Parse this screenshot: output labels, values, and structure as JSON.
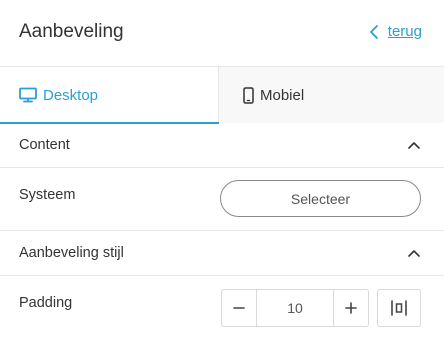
{
  "header": {
    "title": "Aanbeveling",
    "back_label": "terug"
  },
  "tabs": [
    {
      "label": "Desktop",
      "active": true,
      "icon": "desktop-icon"
    },
    {
      "label": "Mobiel",
      "active": false,
      "icon": "mobile-icon"
    }
  ],
  "sections": {
    "content": {
      "title": "Content",
      "fields": {
        "systeem": {
          "label": "Systeem",
          "button_label": "Selecteer"
        }
      }
    },
    "style": {
      "title": "Aanbeveling stijl",
      "fields": {
        "padding": {
          "label": "Padding",
          "value": "10"
        }
      }
    }
  },
  "colors": {
    "accent": "#2a9fd6",
    "text": "#333333",
    "border": "#e6e6e6"
  }
}
